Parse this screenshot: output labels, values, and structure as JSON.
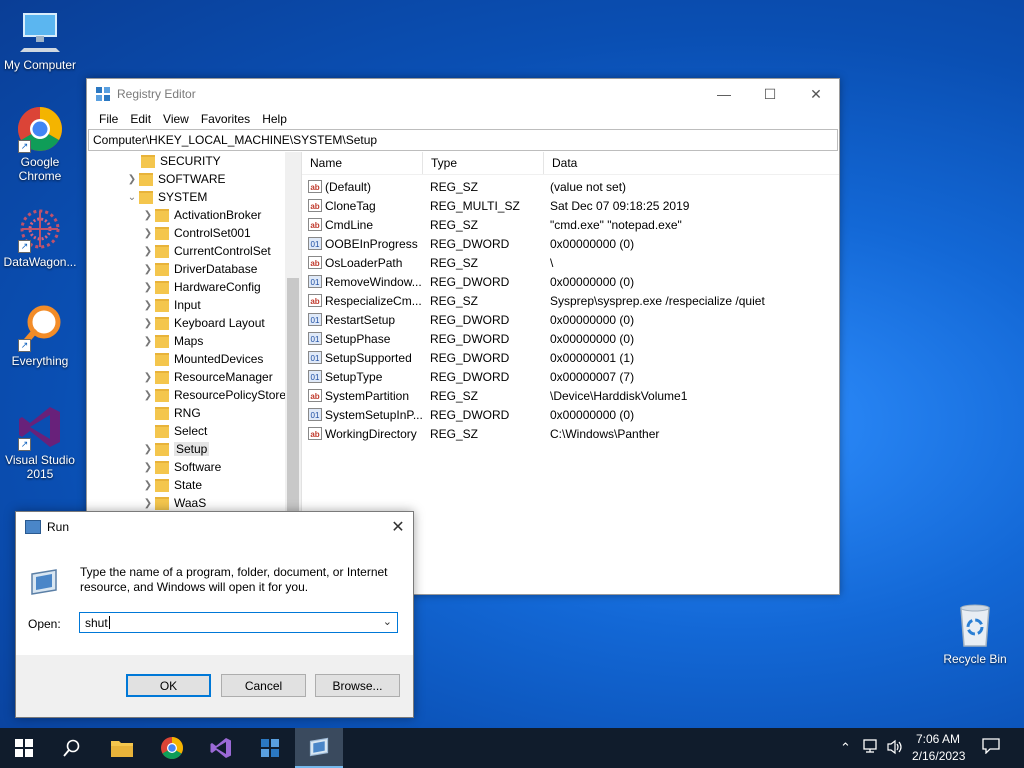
{
  "desktop": {
    "icons": [
      {
        "label": "My Computer"
      },
      {
        "label": "Google Chrome"
      },
      {
        "label": "DataWagon..."
      },
      {
        "label": "Everything"
      },
      {
        "label": "Visual Studio 2015"
      },
      {
        "label": "Recycle Bin"
      }
    ]
  },
  "regedit": {
    "title": "Registry Editor",
    "menu": [
      "File",
      "Edit",
      "View",
      "Favorites",
      "Help"
    ],
    "address": "Computer\\HKEY_LOCAL_MACHINE\\SYSTEM\\Setup",
    "tree": [
      {
        "label": "SECURITY"
      },
      {
        "label": "SOFTWARE"
      },
      {
        "label": "SYSTEM"
      },
      {
        "label": "ActivationBroker"
      },
      {
        "label": "ControlSet001"
      },
      {
        "label": "CurrentControlSet"
      },
      {
        "label": "DriverDatabase"
      },
      {
        "label": "HardwareConfig"
      },
      {
        "label": "Input"
      },
      {
        "label": "Keyboard Layout"
      },
      {
        "label": "Maps"
      },
      {
        "label": "MountedDevices"
      },
      {
        "label": "ResourceManager"
      },
      {
        "label": "ResourcePolicyStore"
      },
      {
        "label": "RNG"
      },
      {
        "label": "Select"
      },
      {
        "label": "Setup"
      },
      {
        "label": "Software"
      },
      {
        "label": "State"
      },
      {
        "label": "WaaS"
      }
    ],
    "columns": {
      "name": "Name",
      "type": "Type",
      "data": "Data"
    },
    "values": [
      {
        "icon": "ab",
        "name": "(Default)",
        "type": "REG_SZ",
        "data": "(value not set)"
      },
      {
        "icon": "ab",
        "name": "CloneTag",
        "type": "REG_MULTI_SZ",
        "data": "Sat Dec 07 09:18:25 2019"
      },
      {
        "icon": "ab",
        "name": "CmdLine",
        "type": "REG_SZ",
        "data": "\"cmd.exe\" \"notepad.exe\""
      },
      {
        "icon": "01",
        "name": "OOBEInProgress",
        "type": "REG_DWORD",
        "data": "0x00000000 (0)"
      },
      {
        "icon": "ab",
        "name": "OsLoaderPath",
        "type": "REG_SZ",
        "data": "\\"
      },
      {
        "icon": "01",
        "name": "RemoveWindow...",
        "type": "REG_DWORD",
        "data": "0x00000000 (0)"
      },
      {
        "icon": "ab",
        "name": "RespecializeCm...",
        "type": "REG_SZ",
        "data": "Sysprep\\sysprep.exe /respecialize /quiet"
      },
      {
        "icon": "01",
        "name": "RestartSetup",
        "type": "REG_DWORD",
        "data": "0x00000000 (0)"
      },
      {
        "icon": "01",
        "name": "SetupPhase",
        "type": "REG_DWORD",
        "data": "0x00000000 (0)"
      },
      {
        "icon": "01",
        "name": "SetupSupported",
        "type": "REG_DWORD",
        "data": "0x00000001 (1)"
      },
      {
        "icon": "01",
        "name": "SetupType",
        "type": "REG_DWORD",
        "data": "0x00000007 (7)"
      },
      {
        "icon": "ab",
        "name": "SystemPartition",
        "type": "REG_SZ",
        "data": "\\Device\\HarddiskVolume1"
      },
      {
        "icon": "01",
        "name": "SystemSetupInP...",
        "type": "REG_DWORD",
        "data": "0x00000000 (0)"
      },
      {
        "icon": "ab",
        "name": "WorkingDirectory",
        "type": "REG_SZ",
        "data": "C:\\Windows\\Panther"
      }
    ]
  },
  "run_dialog": {
    "title": "Run",
    "description": "Type the name of a program, folder, document, or Internet resource, and Windows will open it for you.",
    "open_label": "Open:",
    "open_value": "shut",
    "ok_label": "OK",
    "cancel_label": "Cancel",
    "browse_label": "Browse..."
  },
  "taskbar": {
    "time": "7:06 AM",
    "date": "2/16/2023"
  }
}
